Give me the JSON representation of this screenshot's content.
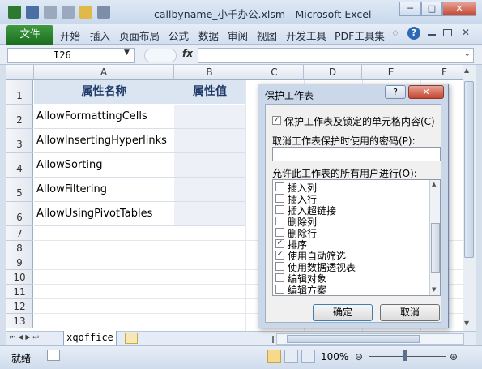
{
  "window": {
    "title": "callbyname_小千办公.xlsm - Microsoft Excel",
    "min": "─",
    "max": "□",
    "close": "✕"
  },
  "ribbon": {
    "file": "文件",
    "tabs": [
      "开始",
      "插入",
      "页面布局",
      "公式",
      "数据",
      "审阅",
      "视图",
      "开发工具",
      "PDF工具集"
    ],
    "help": "?"
  },
  "formula_bar": {
    "name_box": "I26",
    "fx": "fx",
    "value": ""
  },
  "grid": {
    "columns": [
      "A",
      "B",
      "C",
      "D",
      "E",
      "F"
    ],
    "rows": [
      "1",
      "2",
      "3",
      "4",
      "5",
      "6",
      "7",
      "8",
      "9",
      "10",
      "11",
      "12",
      "13"
    ],
    "header_a": "属性名称",
    "header_b": "属性值",
    "cells": [
      "AllowFormattingCells",
      "AllowInsertingHyperlinks",
      "AllowSorting",
      "AllowFiltering",
      "AllowUsingPivotTables"
    ]
  },
  "sheet": {
    "tab": "xqoffice"
  },
  "status": {
    "ready": "就绪",
    "zoom": "100%"
  },
  "dialog": {
    "title": "保护工作表",
    "help": "?",
    "close": "✕",
    "protect_label": "保护工作表及锁定的单元格内容(C)",
    "password_label": "取消工作表保护时使用的密码(P):",
    "allow_label": "允许此工作表的所有用户进行(O):",
    "options": [
      {
        "label": "插入列",
        "checked": false
      },
      {
        "label": "插入行",
        "checked": false
      },
      {
        "label": "插入超链接",
        "checked": false
      },
      {
        "label": "删除列",
        "checked": false
      },
      {
        "label": "删除行",
        "checked": false
      },
      {
        "label": "排序",
        "checked": true
      },
      {
        "label": "使用自动筛选",
        "checked": true
      },
      {
        "label": "使用数据透视表",
        "checked": false
      },
      {
        "label": "编辑对象",
        "checked": false
      },
      {
        "label": "编辑方案",
        "checked": false
      }
    ],
    "ok": "确定",
    "cancel": "取消"
  }
}
